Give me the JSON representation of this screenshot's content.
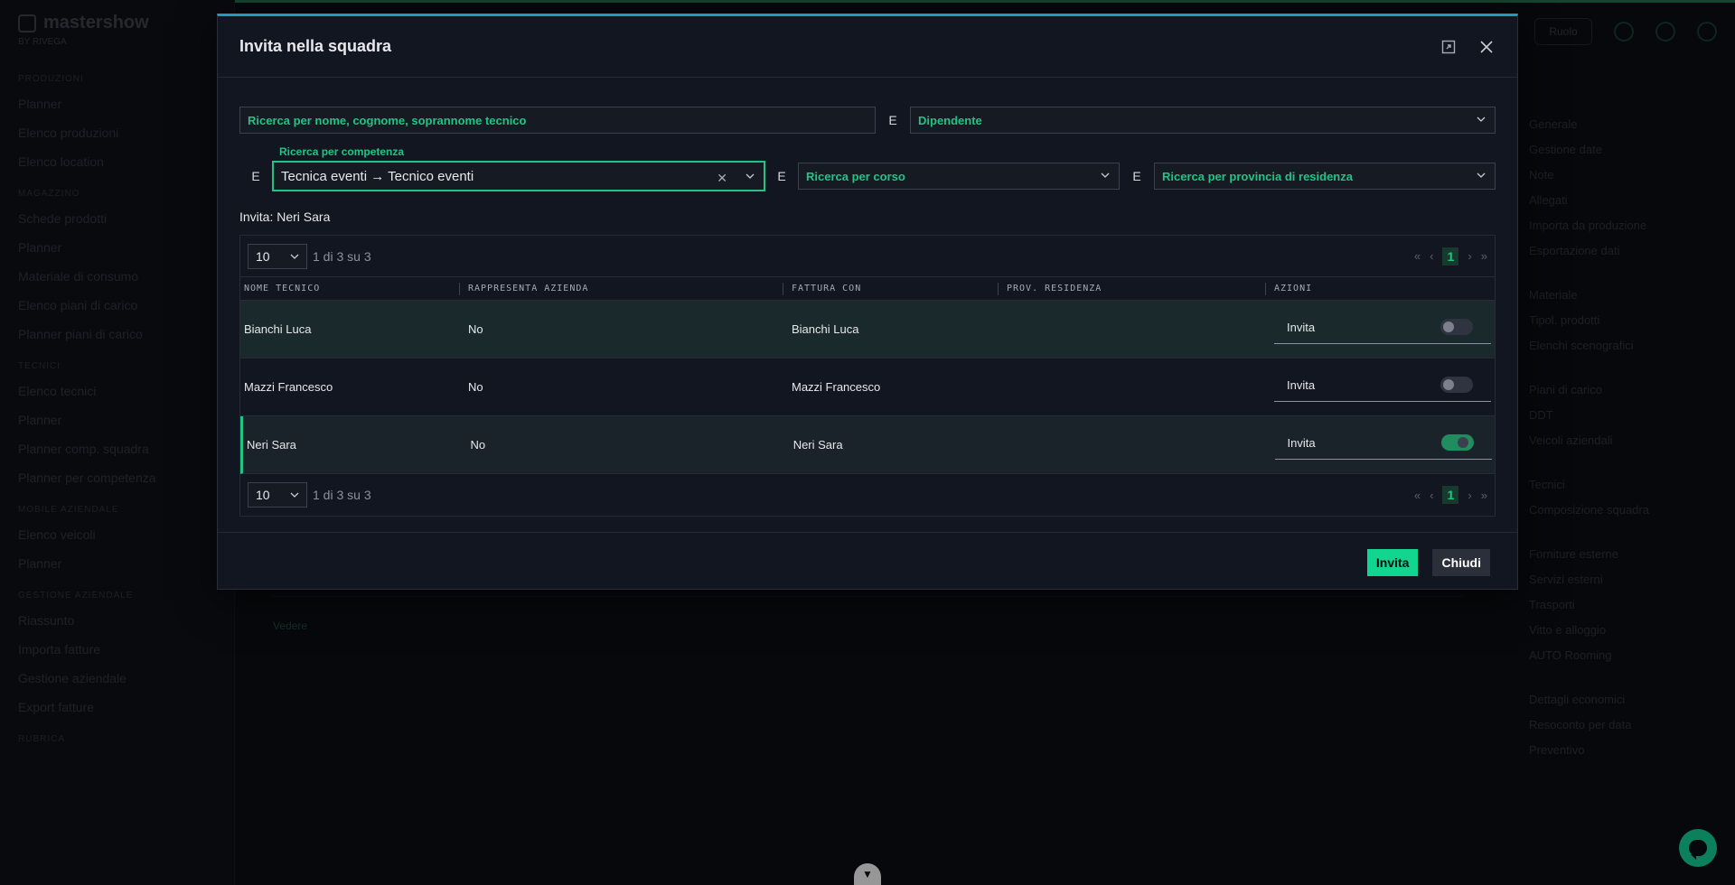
{
  "background": {
    "logo": "mastershow",
    "logo_sub": "BY RIVEGA",
    "sidebar": [
      {
        "section": "Produzioni",
        "items": [
          "Planner",
          "Elenco produzioni",
          "Elenco location"
        ]
      },
      {
        "section": "Magazzino",
        "items": [
          "Schede prodotti",
          "Planner",
          "Materiale di consumo",
          "Elenco piani di carico",
          "Planner piani di carico"
        ]
      },
      {
        "section": "Tecnici",
        "items": [
          "Elenco tecnici",
          "Planner",
          "Planner comp. squadra",
          "Planner per competenza"
        ]
      },
      {
        "section": "Mobile aziendale",
        "items": [
          "Elenco veicoli",
          "Planner"
        ]
      },
      {
        "section": "Gestione aziendale",
        "items": [
          "Riassunto",
          "Importa fatture",
          "Gestione aziendale",
          "Export fatture"
        ]
      },
      {
        "section": "Rubrica",
        "items": []
      }
    ],
    "right_panel": {
      "items": [
        "Generale",
        "Gestione date",
        "Note",
        "Allegati",
        "Importa da produzione",
        "Esportazione dati"
      ],
      "items2": [
        "Materiale",
        "Tipol. prodotti",
        "Elenchi scenografici"
      ],
      "items3": [
        "Piani di carico",
        "DDT",
        "Veicoli aziendali"
      ],
      "items4": [
        "Tecnici",
        "Composizione squadra"
      ],
      "items5": [
        "Forniture esterne",
        "Servizi esterni",
        "Trasporti",
        "Vitto e alloggio",
        "AUTO Rooming"
      ],
      "items6": [
        "Dettagli economici",
        "Resoconto per data",
        "Preventivo"
      ]
    },
    "bottom_panel_label": "Vedere",
    "top_pill": "Ruolo"
  },
  "modal": {
    "title": "Invita nella squadra",
    "filters": {
      "search_placeholder": "Ricerca per nome, cognome, soprannome tecnico",
      "and_label": "E",
      "dipendente": "Dipendente",
      "competenza_label": "Ricerca per competenza",
      "competenza_value": "Tecnica eventi → Tecnico eventi",
      "corso": "Ricerca per corso",
      "provincia": "Ricerca per provincia di residenza"
    },
    "invita_line": "Invita: Neri Sara",
    "pager": {
      "size": "10",
      "info": "1 di 3 su 3",
      "page": "1"
    },
    "columns": [
      "Nome tecnico",
      "Rappresenta azienda",
      "Fattura con",
      "Prov. residenza",
      "Azioni"
    ],
    "rows": [
      {
        "nome": "Bianchi Luca",
        "rappresenta": "No",
        "fattura": "Bianchi Luca",
        "prov": "",
        "azione": "Invita",
        "invited": false
      },
      {
        "nome": "Mazzi Francesco",
        "rappresenta": "No",
        "fattura": "Mazzi Francesco",
        "prov": "",
        "azione": "Invita",
        "invited": false
      },
      {
        "nome": "Neri Sara",
        "rappresenta": "No",
        "fattura": "Neri Sara",
        "prov": "",
        "azione": "Invita",
        "invited": true
      }
    ],
    "footer": {
      "primary": "Invita",
      "secondary": "Chiudi"
    }
  },
  "colors": {
    "accent": "#12d68f",
    "modal_bg": "#121620",
    "top_border": "#1f9ac2"
  },
  "icons": [
    "expand-icon",
    "close-icon",
    "chevron-down-icon",
    "clear-icon",
    "chat-icon"
  ]
}
